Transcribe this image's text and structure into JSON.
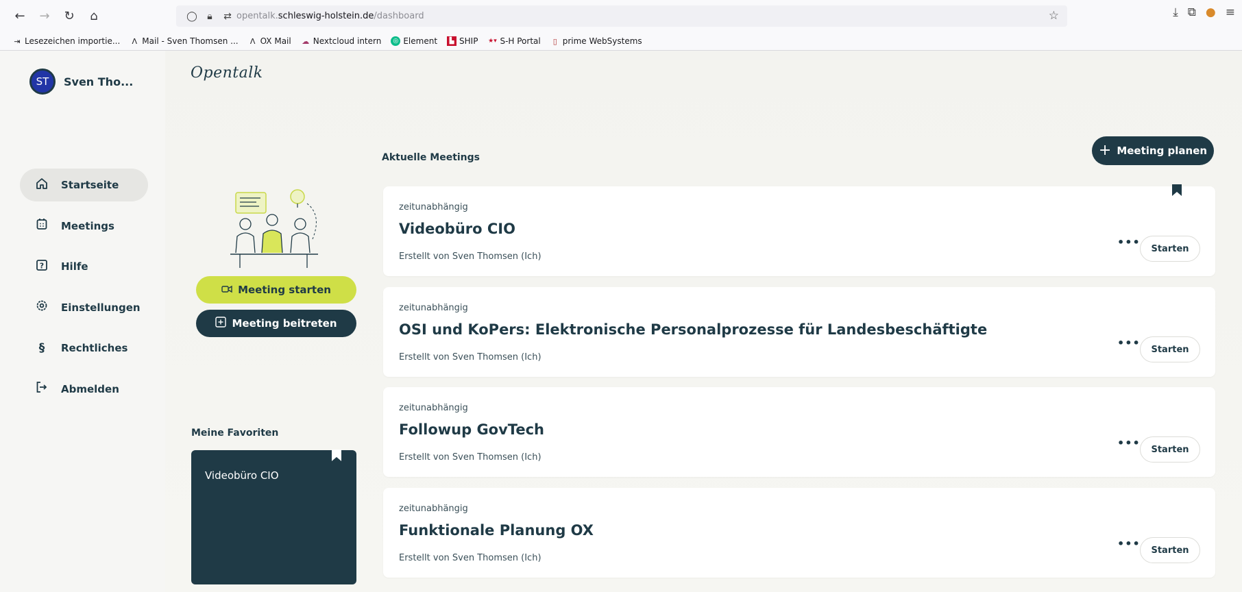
{
  "browser": {
    "url_prefix": "opentalk.",
    "url_host": "schleswig-holstein.de",
    "url_path": "/dashboard",
    "bookmarks": [
      {
        "label": "Lesezeichen importie...",
        "icon": "import-icon"
      },
      {
        "label": "Mail - Sven Thomsen ...",
        "icon": "ox-icon"
      },
      {
        "label": "OX Mail",
        "icon": "ox-icon"
      },
      {
        "label": "Nextcloud intern",
        "icon": "cloud-icon"
      },
      {
        "label": "Element",
        "icon": "element-icon"
      },
      {
        "label": "SHIP",
        "icon": "ship-icon"
      },
      {
        "label": "S-H Portal",
        "icon": "sh-portal-icon"
      },
      {
        "label": "prime WebSystems",
        "icon": "prime-icon"
      }
    ]
  },
  "user": {
    "initials": "ST",
    "name": "Sven Tho..."
  },
  "logo": "Opentalk",
  "sidebar": {
    "items": [
      {
        "label": "Startseite",
        "icon": "home-icon",
        "active": true
      },
      {
        "label": "Meetings",
        "icon": "calendar-icon",
        "active": false
      },
      {
        "label": "Hilfe",
        "icon": "help-icon",
        "active": false
      },
      {
        "label": "Einstellungen",
        "icon": "settings-icon",
        "active": false
      },
      {
        "label": "Rechtliches",
        "icon": "paragraph-icon",
        "active": false
      },
      {
        "label": "Abmelden",
        "icon": "logout-icon",
        "active": false
      }
    ]
  },
  "actions": {
    "start_meeting": "Meeting starten",
    "join_meeting": "Meeting beitreten",
    "plan_meeting": "Meeting planen"
  },
  "favorites": {
    "title": "Meine Favoriten",
    "items": [
      "Videobüro CIO"
    ]
  },
  "meetings": {
    "title": "Aktuelle Meetings",
    "start_label": "Starten",
    "more_label": "•••",
    "items": [
      {
        "time": "zeitunabhängig",
        "title": "Videobüro CIO",
        "creator": "Erstellt von Sven Thomsen (Ich)",
        "favorite": true
      },
      {
        "time": "zeitunabhängig",
        "title": "OSI und KoPers: Elektronische Personalprozesse für Landesbeschäftigte",
        "creator": "Erstellt von Sven Thomsen (Ich)",
        "favorite": false
      },
      {
        "time": "zeitunabhängig",
        "title": "Followup GovTech",
        "creator": "Erstellt von Sven Thomsen (Ich)",
        "favorite": false
      },
      {
        "time": "zeitunabhängig",
        "title": "Funktionale Planung OX",
        "creator": "Erstellt von Sven Thomsen (Ich)",
        "favorite": false
      }
    ]
  },
  "colors": {
    "primary": "#1f3a46",
    "accent": "#cfdf47",
    "avatar": "#2135a6"
  }
}
